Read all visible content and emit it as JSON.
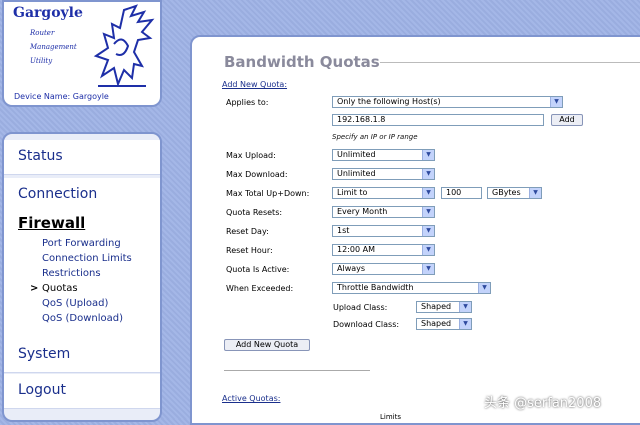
{
  "logo": {
    "title": "Gargoyle",
    "line1": "Router",
    "line2": "Management",
    "line3": "Utility",
    "device_name": "Device Name: Gargoyle"
  },
  "nav": {
    "status": "Status",
    "connection": "Connection",
    "firewall": "Firewall",
    "firewall_items": [
      "Port Forwarding",
      "Connection Limits",
      "Restrictions",
      "Quotas",
      "QoS (Upload)",
      "QoS (Download)"
    ],
    "active_marker": ">",
    "system": "System",
    "logout": "Logout"
  },
  "page": {
    "title": "Bandwidth Quotas",
    "add_new_label": "Add New Quota:",
    "applies_to_label": "Applies to:",
    "applies_to_value": "Only the following Host(s)",
    "ip_value": "192.168.1.8",
    "add_button": "Add",
    "ip_hint": "Specify an IP or IP range",
    "max_upload_label": "Max Upload:",
    "max_upload_value": "Unlimited",
    "max_download_label": "Max Download:",
    "max_download_value": "Unlimited",
    "max_total_label": "Max Total Up+Down:",
    "max_total_value": "Limit to",
    "max_total_amount": "100",
    "max_total_unit": "GBytes",
    "quota_resets_label": "Quota Resets:",
    "quota_resets_value": "Every Month",
    "reset_day_label": "Reset Day:",
    "reset_day_value": "1st",
    "reset_hour_label": "Reset Hour:",
    "reset_hour_value": "12:00 AM",
    "quota_active_label": "Quota Is Active:",
    "quota_active_value": "Always",
    "when_exceeded_label": "When Exceeded:",
    "when_exceeded_value": "Throttle Bandwidth",
    "upload_class_label": "Upload Class:",
    "upload_class_value": "Shaped",
    "download_class_label": "Download Class:",
    "download_class_value": "Shaped",
    "add_new_quota_button": "Add New Quota",
    "active_quotas_label": "Active Quotas:",
    "limits_header": "Limits"
  },
  "watermark": "头条 @serfan2008",
  "icons": {
    "dropdown": "chevron-down-icon",
    "logo": "gargoyle-dragon-icon"
  }
}
